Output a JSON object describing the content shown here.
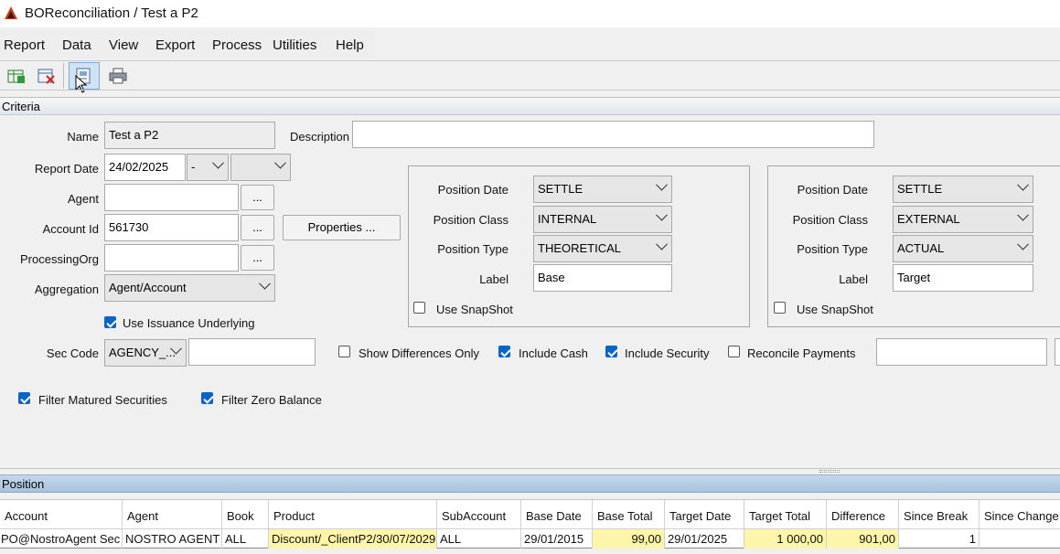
{
  "window": {
    "title": "BOReconciliation / Test a P2"
  },
  "menu": [
    "Report",
    "Data",
    "View",
    "Export",
    "Process",
    "Utilities",
    "Help"
  ],
  "toolbar": {
    "buttons": [
      "new-report-icon",
      "close-report-icon",
      "load-report-icon",
      "print-icon"
    ]
  },
  "sections": {
    "criteria": "Criteria",
    "position": "Position"
  },
  "criteria": {
    "name_label": "Name",
    "name_value": "Test a P2",
    "description_label": "Description",
    "description_value": "",
    "report_date_label": "Report Date",
    "report_date_value": "24/02/2025",
    "report_date_offset": "-",
    "report_date_extra": "",
    "agent_label": "Agent",
    "agent_value": "",
    "account_id_label": "Account Id",
    "account_id_value": "561730",
    "processing_org_label": "ProcessingOrg",
    "processing_org_value": "",
    "aggregation_label": "Aggregation",
    "aggregation_value": "Agent/Account",
    "ellipsis": "...",
    "properties_button": "Properties ...",
    "use_issuance_underlying": "Use Issuance Underlying",
    "sec_code_label": "Sec Code",
    "sec_code_type": "AGENCY_...",
    "sec_code_value": "",
    "show_differences_only": "Show Differences Only",
    "include_cash": "Include Cash",
    "include_security": "Include Security",
    "reconcile_payments": "Reconcile Payments",
    "reconcile_payments_value": "",
    "filter_matured_securities": "Filter Matured Securities",
    "filter_zero_balance": "Filter Zero Balance"
  },
  "base_panel": {
    "position_date_label": "Position Date",
    "position_date": "SETTLE",
    "position_class_label": "Position Class",
    "position_class": "INTERNAL",
    "position_type_label": "Position Type",
    "position_type": "THEORETICAL",
    "label_label": "Label",
    "label": "Base",
    "use_snapshot": "Use SnapShot"
  },
  "target_panel": {
    "position_date_label": "Position Date",
    "position_date": "SETTLE",
    "position_class_label": "Position Class",
    "position_class": "EXTERNAL",
    "position_type_label": "Position Type",
    "position_type": "ACTUAL",
    "label_label": "Label",
    "label": "Target",
    "use_snapshot": "Use SnapShot"
  },
  "grid": {
    "columns": [
      "Account",
      "Agent",
      "Book",
      "Product",
      "SubAccount",
      "Base Date",
      "Base Total",
      "Target Date",
      "Target Total",
      "Difference",
      "Since Break",
      "Since Change"
    ],
    "rows": [
      [
        "PO@NostroAgent Sec",
        "NOSTRO AGENT",
        "ALL",
        "Discount/_ClientP2/30/07/2029",
        "ALL",
        "29/01/2015",
        "99,00",
        "29/01/2025",
        "1 000,00",
        "901,00",
        "1",
        ""
      ]
    ]
  },
  "colors": {
    "highlight": "#fdf6a8",
    "checkbox": "#0a64c8",
    "position_header": "#b3cbe3"
  }
}
